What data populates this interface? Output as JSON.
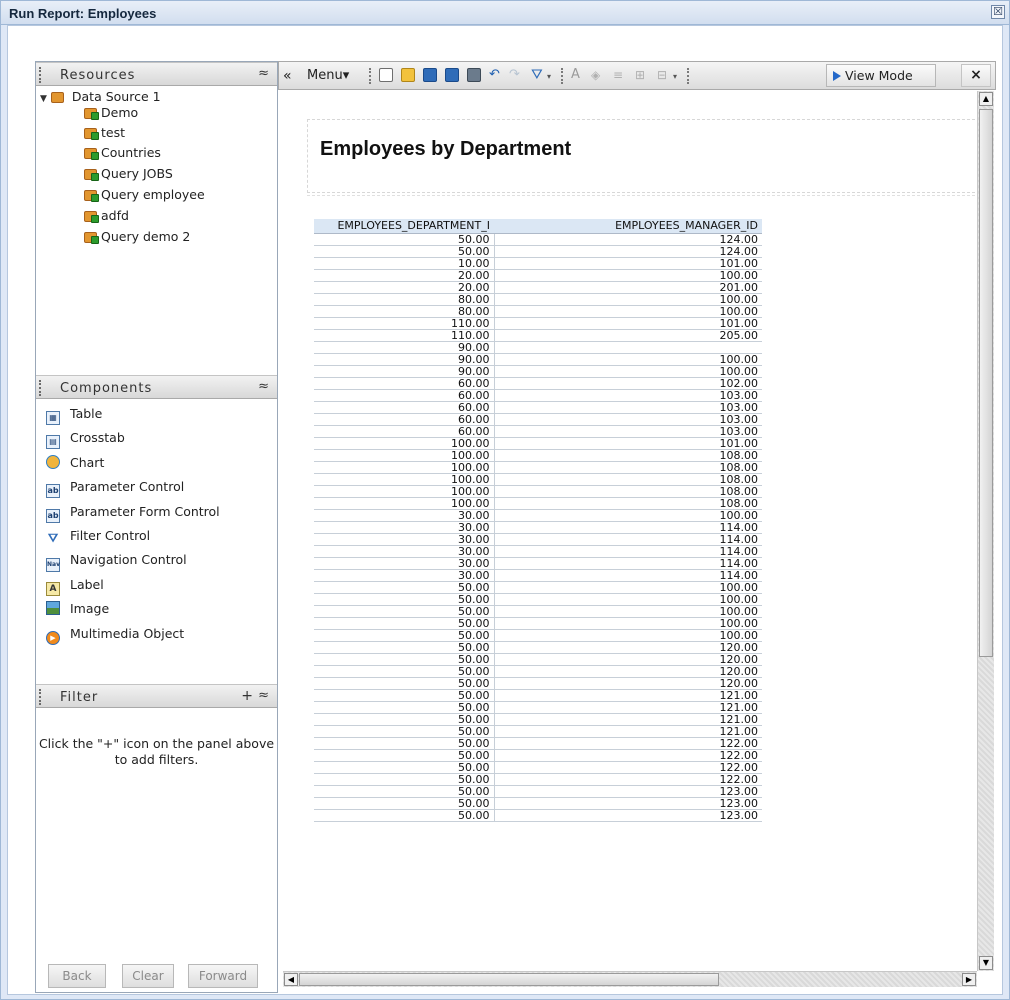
{
  "window": {
    "title": "Run Report: Employees",
    "close_glyph": "☒"
  },
  "resources": {
    "header": "Resources",
    "collapse_glyph": "≈",
    "data_source": "Data Source 1",
    "items": [
      "Demo",
      "test",
      "Countries",
      "Query JOBS",
      "Query employee",
      "adfd",
      "Query demo 2"
    ]
  },
  "components": {
    "header": "Components",
    "collapse_glyph": "≈",
    "items": [
      {
        "label": "Table",
        "icon": "table-icon"
      },
      {
        "label": "Crosstab",
        "icon": "crosstab-icon"
      },
      {
        "label": "Chart",
        "icon": "chart-icon"
      },
      {
        "label": "Parameter Control",
        "icon": "parameter-control-icon"
      },
      {
        "label": "Parameter Form Control",
        "icon": "parameter-form-control-icon"
      },
      {
        "label": "Filter Control",
        "icon": "filter-control-icon"
      },
      {
        "label": "Navigation Control",
        "icon": "navigation-control-icon"
      },
      {
        "label": "Label",
        "icon": "label-icon"
      },
      {
        "label": "Image",
        "icon": "image-icon"
      },
      {
        "label": "Multimedia Object",
        "icon": "multimedia-object-icon"
      }
    ]
  },
  "filter": {
    "header": "Filter",
    "add_glyph": "+",
    "collapse_glyph": "≈",
    "message": "Click the \"+\" icon on the panel above to add filters."
  },
  "nav_buttons": {
    "back": "Back",
    "clear": "Clear",
    "forward": "Forward"
  },
  "toolbar": {
    "collapse_glyph": "«",
    "menu_label": "Menu▾",
    "view_mode_label": "View Mode",
    "close_label": "×"
  },
  "report": {
    "title": "Employees by Department",
    "columns": [
      "EMPLOYEES_DEPARTMENT_I",
      "EMPLOYEES_MANAGER_ID"
    ],
    "rows": [
      [
        "50.00",
        "124.00"
      ],
      [
        "50.00",
        "124.00"
      ],
      [
        "10.00",
        "101.00"
      ],
      [
        "20.00",
        "100.00"
      ],
      [
        "20.00",
        "201.00"
      ],
      [
        "80.00",
        "100.00"
      ],
      [
        "80.00",
        "100.00"
      ],
      [
        "110.00",
        "101.00"
      ],
      [
        "110.00",
        "205.00"
      ],
      [
        "90.00",
        ""
      ],
      [
        "90.00",
        "100.00"
      ],
      [
        "90.00",
        "100.00"
      ],
      [
        "60.00",
        "102.00"
      ],
      [
        "60.00",
        "103.00"
      ],
      [
        "60.00",
        "103.00"
      ],
      [
        "60.00",
        "103.00"
      ],
      [
        "60.00",
        "103.00"
      ],
      [
        "100.00",
        "101.00"
      ],
      [
        "100.00",
        "108.00"
      ],
      [
        "100.00",
        "108.00"
      ],
      [
        "100.00",
        "108.00"
      ],
      [
        "100.00",
        "108.00"
      ],
      [
        "100.00",
        "108.00"
      ],
      [
        "30.00",
        "100.00"
      ],
      [
        "30.00",
        "114.00"
      ],
      [
        "30.00",
        "114.00"
      ],
      [
        "30.00",
        "114.00"
      ],
      [
        "30.00",
        "114.00"
      ],
      [
        "30.00",
        "114.00"
      ],
      [
        "50.00",
        "100.00"
      ],
      [
        "50.00",
        "100.00"
      ],
      [
        "50.00",
        "100.00"
      ],
      [
        "50.00",
        "100.00"
      ],
      [
        "50.00",
        "100.00"
      ],
      [
        "50.00",
        "120.00"
      ],
      [
        "50.00",
        "120.00"
      ],
      [
        "50.00",
        "120.00"
      ],
      [
        "50.00",
        "120.00"
      ],
      [
        "50.00",
        "121.00"
      ],
      [
        "50.00",
        "121.00"
      ],
      [
        "50.00",
        "121.00"
      ],
      [
        "50.00",
        "121.00"
      ],
      [
        "50.00",
        "122.00"
      ],
      [
        "50.00",
        "122.00"
      ],
      [
        "50.00",
        "122.00"
      ],
      [
        "50.00",
        "122.00"
      ],
      [
        "50.00",
        "123.00"
      ],
      [
        "50.00",
        "123.00"
      ],
      [
        "50.00",
        "123.00"
      ]
    ]
  }
}
